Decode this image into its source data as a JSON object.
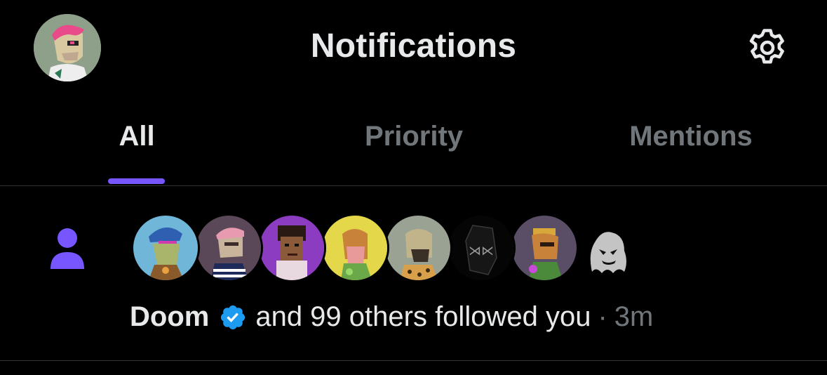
{
  "header": {
    "title": "Notifications",
    "avatar_icon": "ape-avatar-pink-hair",
    "settings_icon": "gear-icon"
  },
  "tabs": [
    {
      "label": "All",
      "active": true
    },
    {
      "label": "Priority",
      "active": false
    },
    {
      "label": "Mentions",
      "active": false
    }
  ],
  "colors": {
    "accent": "#7856ff",
    "text_primary": "#e7e9ea",
    "text_secondary": "#71767b",
    "divider": "#2f3336",
    "verified": "#1d9bf0",
    "background": "#000000"
  },
  "notification": {
    "type_icon": "person-icon",
    "follower_avatars": [
      "ape-avatar-blue-bg",
      "ape-avatar-pink-hair",
      "pixel-punk-avatar",
      "ape-avatar-yellow-bg",
      "ape-avatar-grey-bg",
      "black-crystal-avatar",
      "ape-avatar-purple-bg",
      "ghost-avatar"
    ],
    "name": "Doom",
    "verified": true,
    "text": "and 99 others followed you",
    "separator": "·",
    "time": "3m"
  }
}
